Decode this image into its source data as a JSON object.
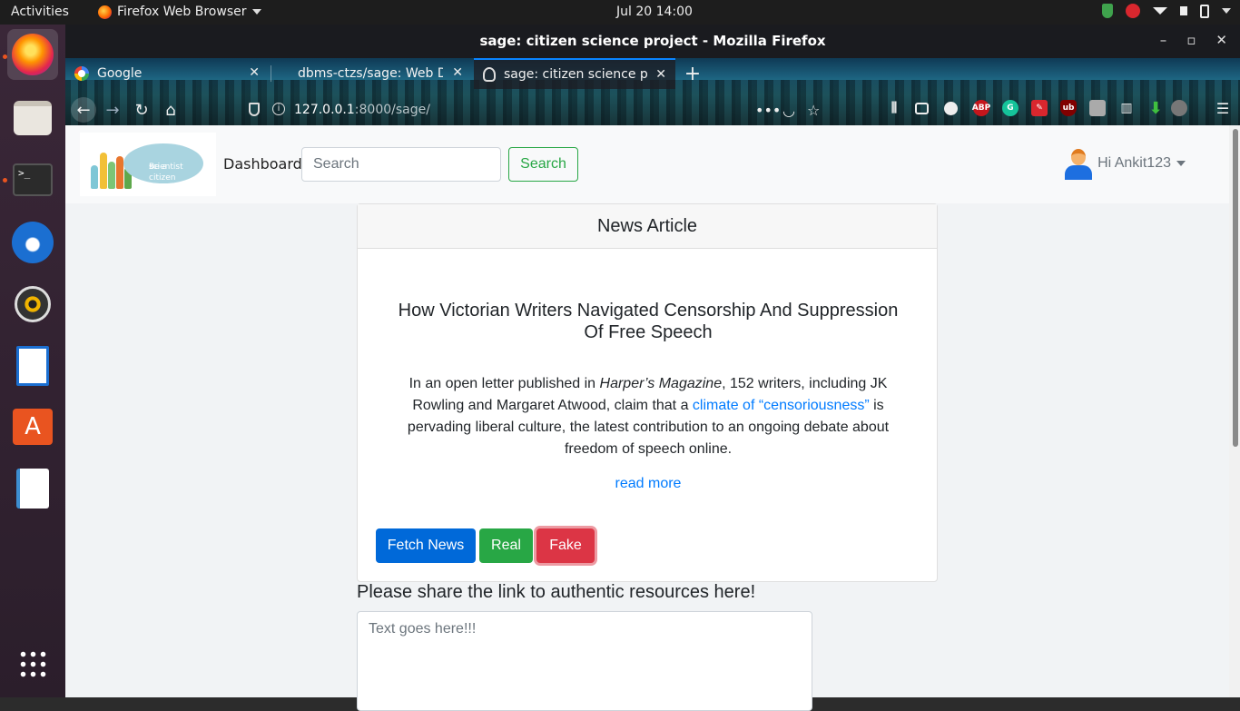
{
  "topbar": {
    "activities": "Activities",
    "app_name": "Firefox Web Browser",
    "clock": "Jul 20  14:00"
  },
  "window": {
    "title": "sage: citizen science project - Mozilla Firefox"
  },
  "tabs": [
    {
      "label": "Google",
      "icon": "google-icon"
    },
    {
      "label": "dbms-ctzs/sage: Web De",
      "icon": "github-icon"
    },
    {
      "label": "sage: citizen science proj",
      "icon": "lightbulb-icon",
      "selected": true
    }
  ],
  "urlbar": {
    "host": "127.0.0.1",
    "rest": ":8000/sage/"
  },
  "navbar": {
    "logo_line1": "Be a citizen",
    "logo_line2": "scientist",
    "dashboard": "Dashboard",
    "search_placeholder": "Search",
    "search_button": "Search",
    "user_greeting": "Hi Ankit123"
  },
  "card": {
    "header": "News Article",
    "title": "How Victorian Writers Navigated Censorship And Suppression Of Free Speech",
    "body_pre": "In an open letter published in ",
    "body_italic": "Harper’s Magazine",
    "body_mid": ", 152 writers, including JK Rowling and Margaret Atwood, claim that a ",
    "body_link": "climate of “censoriousness”",
    "body_post": " is pervading liberal culture, the latest contribution to an ongoing debate about freedom of speech online.",
    "read_more": "read more",
    "buttons": {
      "fetch": "Fetch News",
      "real": "Real",
      "fake": "Fake"
    }
  },
  "share": {
    "label": "Please share the link to authentic resources here!",
    "placeholder": "Text goes here!!!"
  },
  "colors": {
    "primary": "#0069d9",
    "success": "#28a745",
    "danger": "#dc3545",
    "link": "#007bff"
  }
}
